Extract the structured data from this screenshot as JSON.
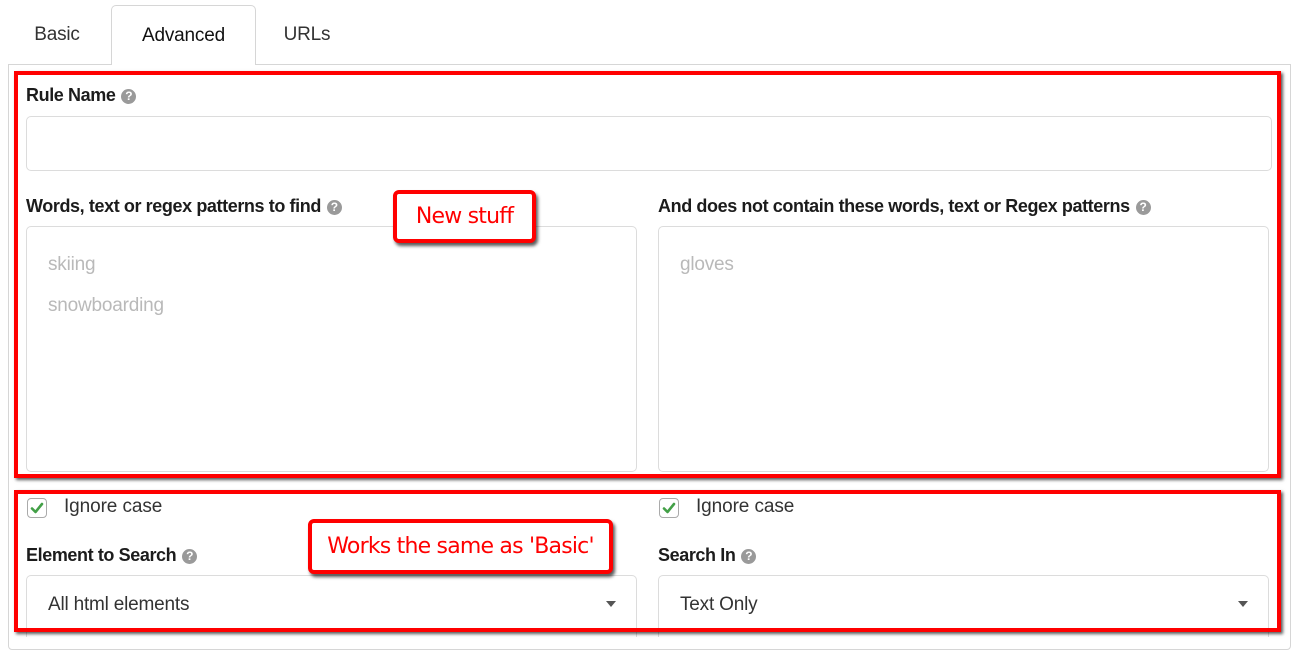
{
  "tabs": [
    {
      "label": "Basic",
      "active": false
    },
    {
      "label": "Advanced",
      "active": true
    },
    {
      "label": "URLs",
      "active": false
    }
  ],
  "form": {
    "rule_name": {
      "label": "Rule Name",
      "value": ""
    },
    "find_patterns": {
      "label": "Words, text or regex patterns to find",
      "placeholder_lines": [
        "skiing",
        "snowboarding"
      ]
    },
    "exclude_patterns": {
      "label": "And does not contain these words, text or Regex patterns",
      "placeholder_lines": [
        "gloves"
      ]
    },
    "ignore_case_find": {
      "label": "Ignore case",
      "checked": true
    },
    "ignore_case_exclude": {
      "label": "Ignore case",
      "checked": true
    },
    "element_to_search": {
      "label": "Element to Search",
      "selected": "All html elements"
    },
    "search_in": {
      "label": "Search In",
      "selected": "Text Only"
    }
  },
  "help_glyph": "?",
  "annotations": {
    "new_stuff": "New stuff",
    "works_same": "Works the same as 'Basic'",
    "color": "#ff0000"
  }
}
